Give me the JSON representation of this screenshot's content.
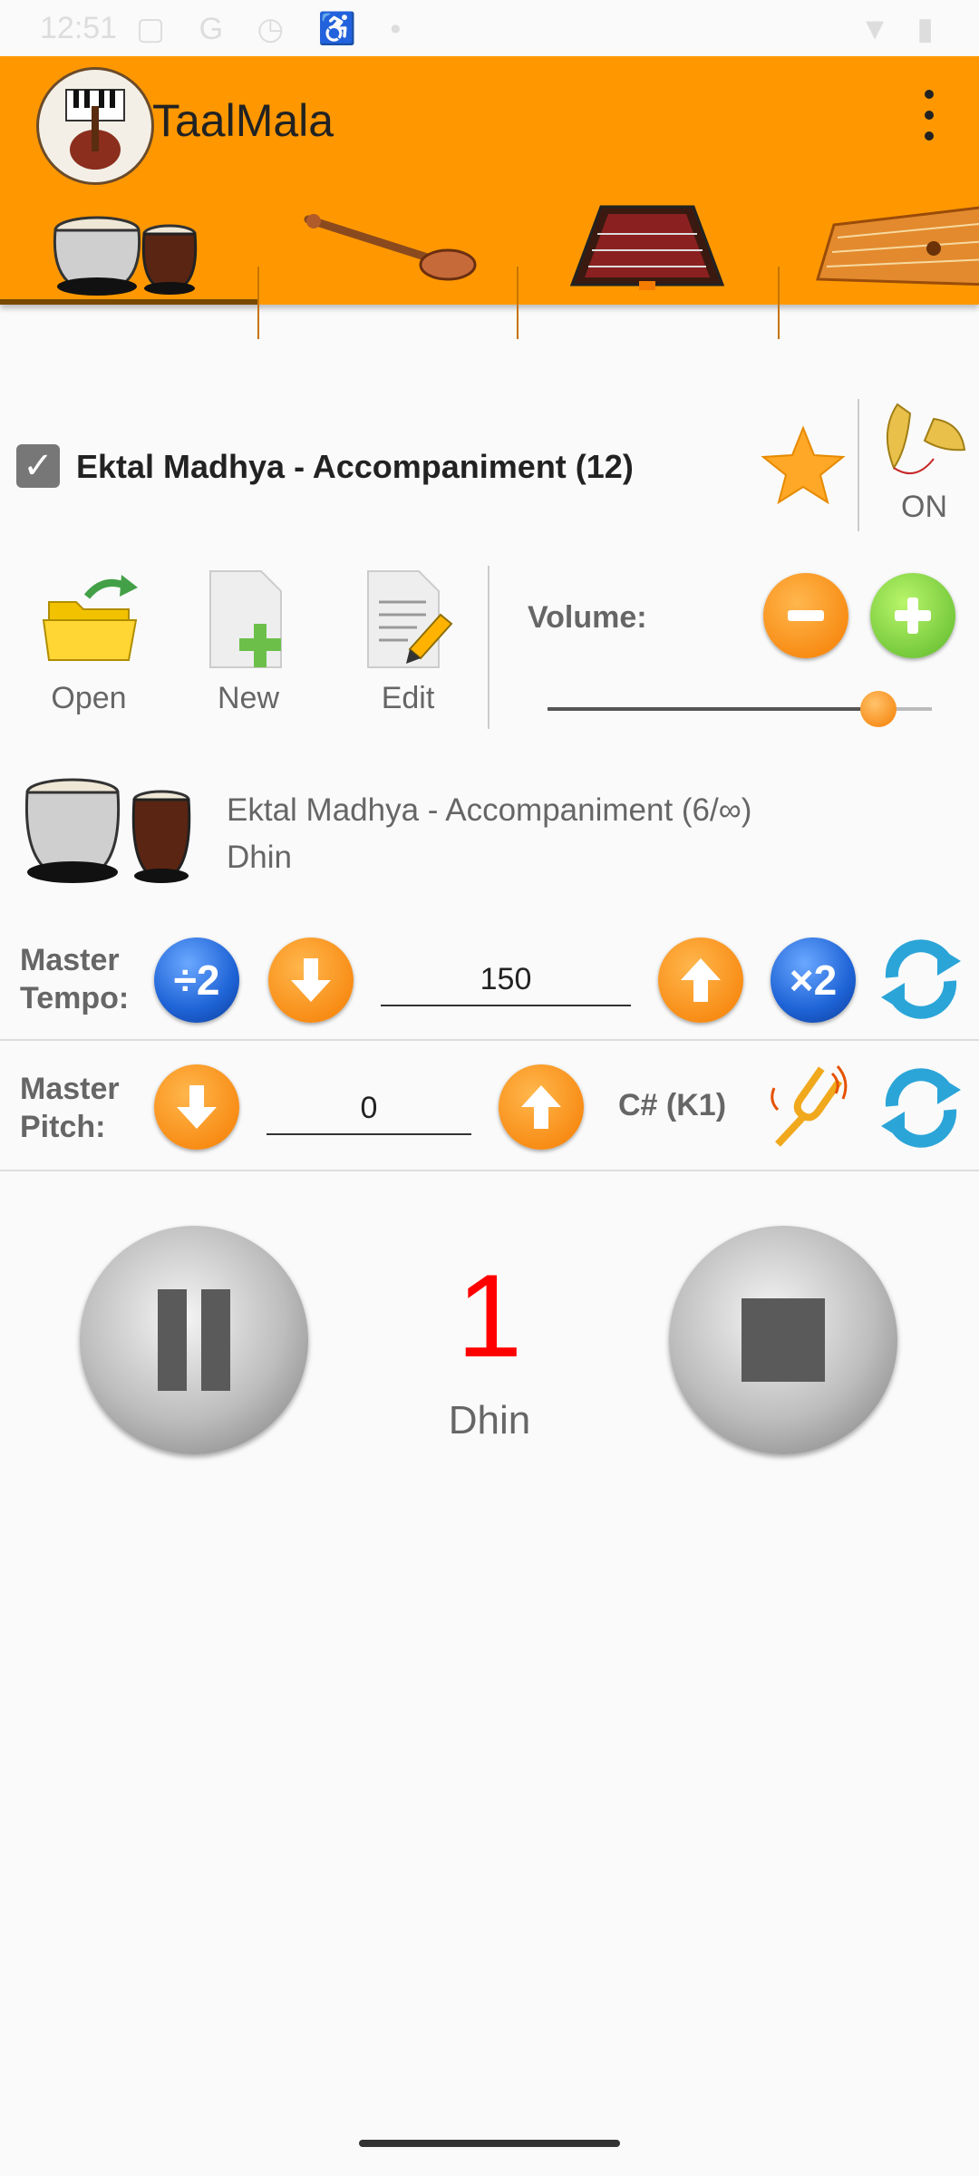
{
  "status_bar": {
    "time": "12:51"
  },
  "app": {
    "title": "TaalMala"
  },
  "tabs": [
    {
      "name": "tabla"
    },
    {
      "name": "sitar"
    },
    {
      "name": "santoor"
    },
    {
      "name": "swarmandal"
    }
  ],
  "rhythm": {
    "title": "Ektal Madhya - Accompaniment (12)",
    "checked": true,
    "cymbal_state": "ON"
  },
  "toolbar": {
    "open_label": "Open",
    "new_label": "New",
    "edit_label": "Edit"
  },
  "volume": {
    "label": "Volume:",
    "level": 0.86
  },
  "now_playing": {
    "line1": "Ektal Madhya - Accompaniment (6/∞)",
    "line2": "Dhin"
  },
  "tempo": {
    "label_line1": "Master",
    "label_line2": "Tempo:",
    "value": "150",
    "halve_label": "÷2",
    "double_label": "×2"
  },
  "pitch": {
    "label_line1": "Master",
    "label_line2": "Pitch:",
    "value": "0",
    "note": "C# (K1)"
  },
  "playback": {
    "beat_number": "1",
    "beat_name": "Dhin"
  },
  "colors": {
    "accent": "#ff9800",
    "beat_count": "#ff0000",
    "blue_button": "#1e63d6"
  }
}
